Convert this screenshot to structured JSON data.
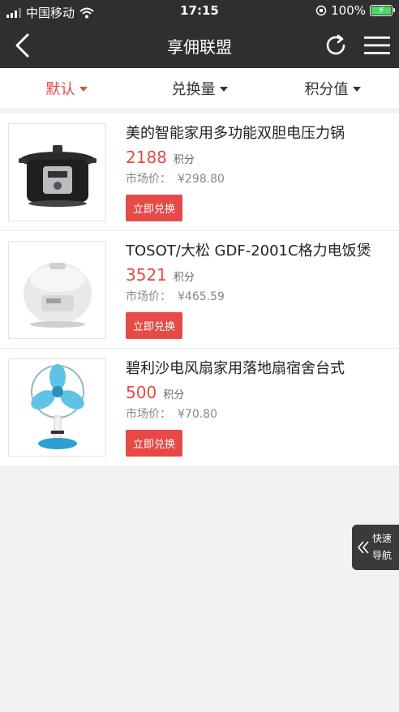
{
  "status_bar": {
    "carrier": "中国移动",
    "time": "17:15",
    "battery": "100%"
  },
  "navbar": {
    "title": "享佣联盟"
  },
  "sort_tabs": [
    {
      "label": "默认"
    },
    {
      "label": "兑换量"
    },
    {
      "label": "积分值"
    }
  ],
  "products": [
    {
      "name": "美的智能家用多功能双胆电压力锅",
      "points": "2188",
      "points_unit": "积分",
      "market_label": "市场价：",
      "market_price": "¥298.80",
      "button": "立即兑换"
    },
    {
      "name": "TOSOT/大松 GDF-2001C格力电饭煲",
      "points": "3521",
      "points_unit": "积分",
      "market_label": "市场价：",
      "market_price": "¥465.59",
      "button": "立即兑换"
    },
    {
      "name": "碧利沙电风扇家用落地扇宿舍台式",
      "points": "500",
      "points_unit": "积分",
      "market_label": "市场价：",
      "market_price": "¥70.80",
      "button": "立即兑换"
    }
  ],
  "fast_nav": {
    "line1": "快速",
    "line2": "导航"
  },
  "colors": {
    "accent": "#e64a46",
    "header_bg": "#2f2f2f",
    "battery": "#4cd964"
  }
}
